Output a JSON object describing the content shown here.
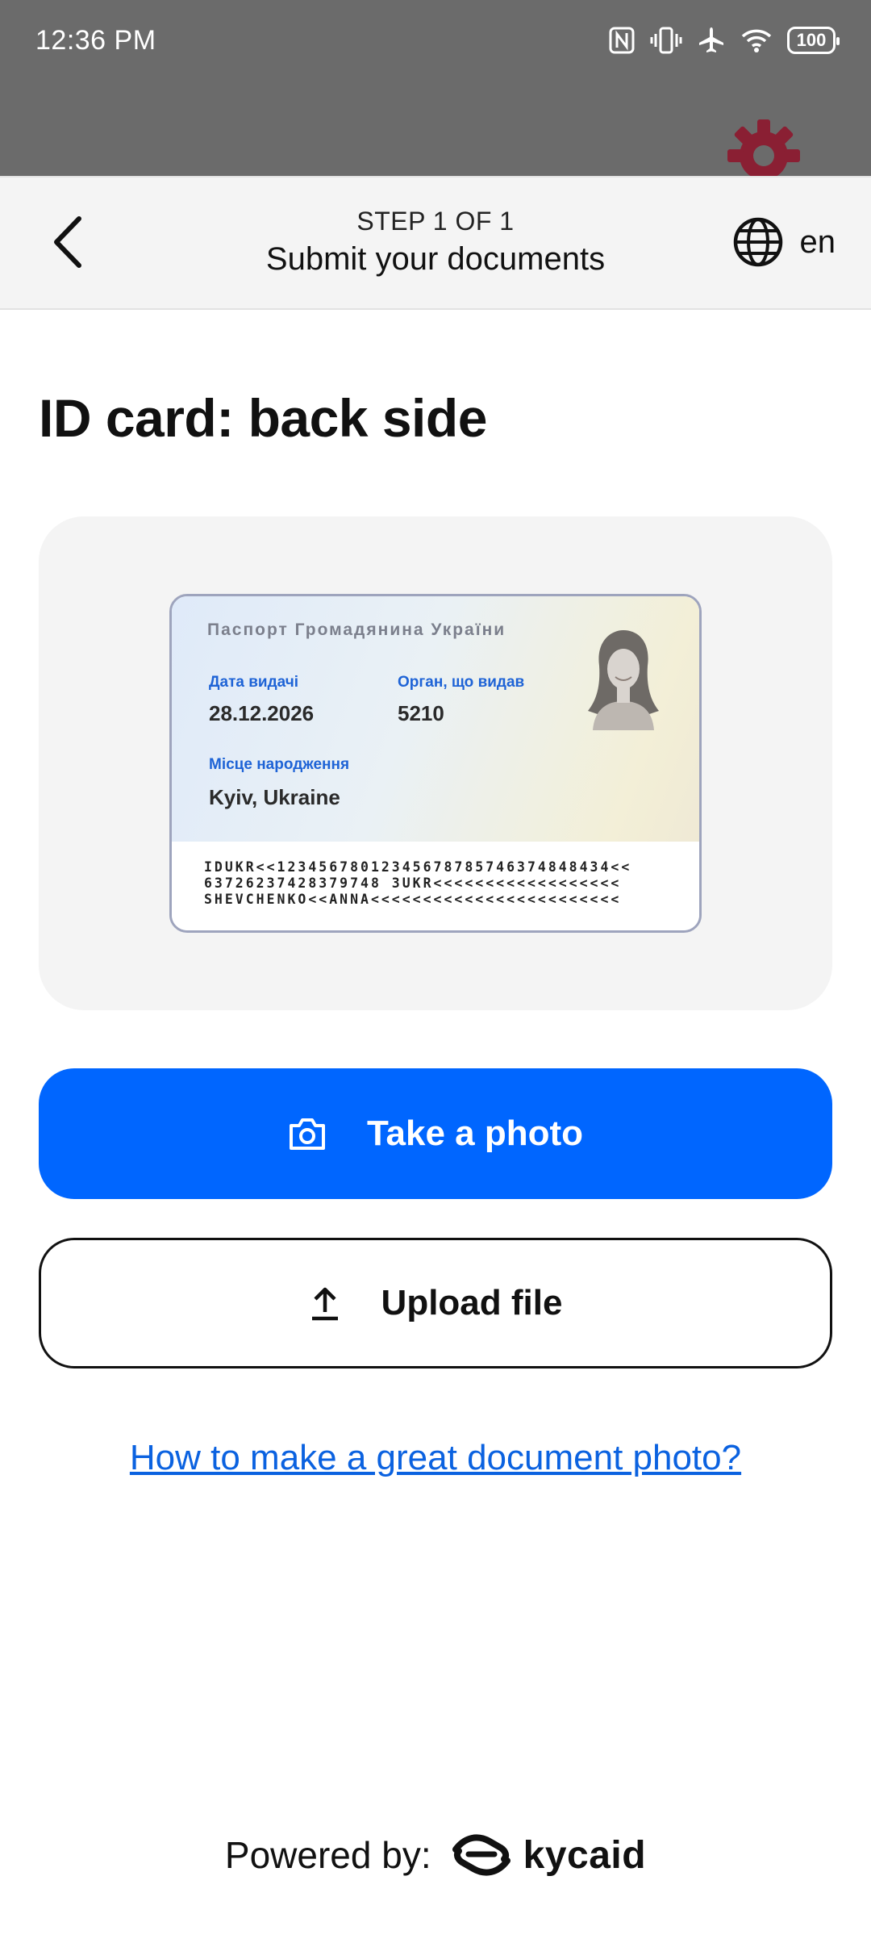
{
  "status_bar": {
    "time": "12:36 PM",
    "battery": "100"
  },
  "header": {
    "step": "STEP 1 OF 1",
    "title": "Submit your documents",
    "language": "en"
  },
  "page": {
    "title": "ID card: back side"
  },
  "id_card_sample": {
    "heading": "Паспорт Громадянина України",
    "issue_date_label": "Дата видачі",
    "issue_date": "28.12.2026",
    "authority_label": "Орган, що видав",
    "authority": "5210",
    "birthplace_label": "Місце народження",
    "birthplace": "Kyiv, Ukraine",
    "mrz": [
      "IDUKR<<12345678012345678785746374848434<<",
      "63726237428379748 3UKR<<<<<<<<<<<<<<<<<<",
      "SHEVCHENKO<<ANNA<<<<<<<<<<<<<<<<<<<<<<<<"
    ]
  },
  "actions": {
    "take_photo": "Take a photo",
    "upload_file": "Upload file",
    "help_link": "How to make a great document photo?"
  },
  "footer": {
    "powered_by": "Powered by:",
    "brand": "kycaid"
  },
  "colors": {
    "primary": "#0066ff",
    "link": "#0b62e0",
    "status_bg": "#6b6b6b",
    "header_bg": "#f4f4f4",
    "card_label": "#1e63d6"
  },
  "icons": {
    "back": "chevron-left-icon",
    "language": "globe-icon",
    "take_photo": "camera-icon",
    "upload": "upload-icon"
  }
}
